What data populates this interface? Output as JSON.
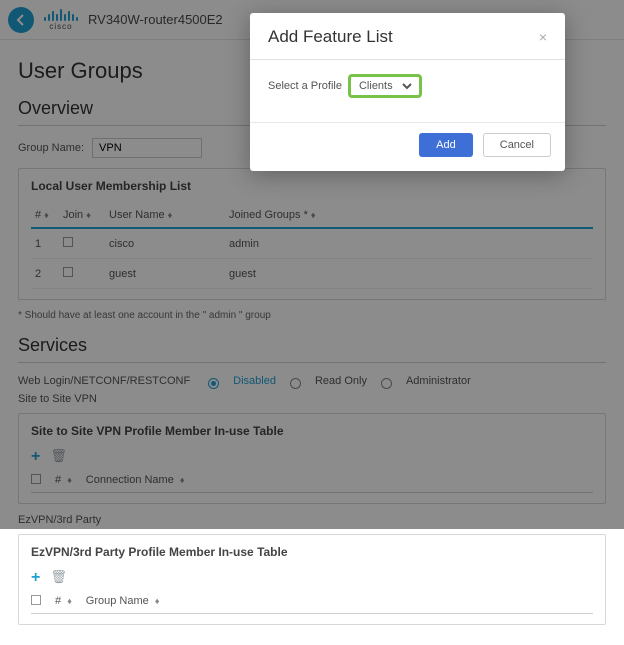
{
  "header": {
    "device_name": "RV340W-router4500E2",
    "brand": "cisco"
  },
  "page": {
    "title": "User Groups"
  },
  "overview": {
    "title": "Overview",
    "group_name_label": "Group Name:",
    "group_name_value": "VPN"
  },
  "membership": {
    "title": "Local User Membership List",
    "columns": {
      "num": "#",
      "join": "Join",
      "user_name": "User Name",
      "joined_groups": "Joined Groups *"
    },
    "rows": [
      {
        "num": "1",
        "user_name": "cisco",
        "joined_groups": "admin"
      },
      {
        "num": "2",
        "user_name": "guest",
        "joined_groups": "guest"
      }
    ],
    "footnote": "* Should have at least one account in the \" admin \" group"
  },
  "services": {
    "title": "Services",
    "radio_label": "Web Login/NETCONF/RESTCONF",
    "options": {
      "disabled": "Disabled",
      "read_only": "Read Only",
      "administrator": "Administrator"
    },
    "s2s_label": "Site to Site VPN",
    "s2s_table": {
      "title": "Site to Site VPN Profile Member In-use Table",
      "col_num": "#",
      "col_name": "Connection Name"
    },
    "ez_label": "EzVPN/3rd Party",
    "ez_table": {
      "title": "EzVPN/3rd Party Profile Member In-use Table",
      "col_num": "#",
      "col_name": "Group Name"
    }
  },
  "modal": {
    "title": "Add Feature List",
    "select_label": "Select a Profile",
    "select_value": "Clients",
    "add": "Add",
    "cancel": "Cancel"
  }
}
